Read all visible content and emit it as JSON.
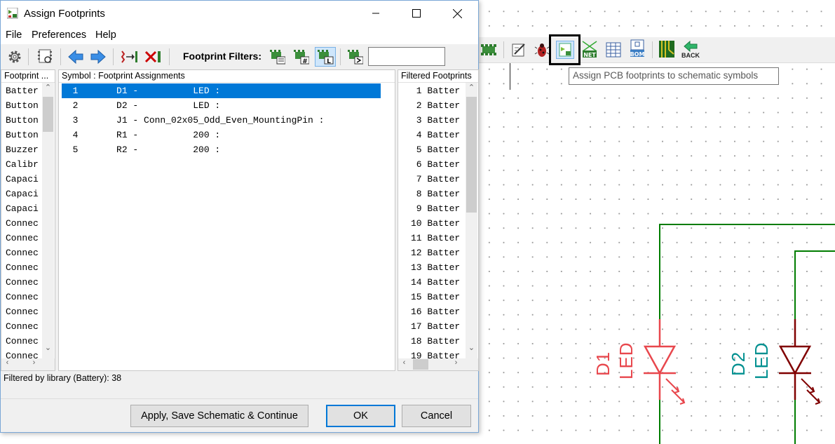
{
  "dialog": {
    "title": "Assign Footprints",
    "window_controls": [
      "minimize-icon",
      "maximize-icon",
      "close-icon"
    ]
  },
  "menu": [
    "File",
    "Preferences",
    "Help"
  ],
  "toolbar": {
    "filters_label": "Footprint Filters:",
    "filter_input_value": ""
  },
  "libraries_panel": {
    "header": "Footprint ...",
    "items": [
      "Batter",
      "Button",
      "Button",
      "Button",
      "Buzzer",
      "Calibr",
      "Capaci",
      "Capaci",
      "Capaci",
      "Connec",
      "Connec",
      "Connec",
      "Connec",
      "Connec",
      "Connec",
      "Connec",
      "Connec",
      "Connec",
      "Connec"
    ]
  },
  "assign_panel": {
    "header": "Symbol : Footprint Assignments",
    "rows": [
      {
        "text": "  1       D1 -          LED :",
        "selected": true
      },
      {
        "text": "  2       D2 -          LED :",
        "selected": false
      },
      {
        "text": "  3       J1 - Conn_02x05_Odd_Even_MountingPin :",
        "selected": false
      },
      {
        "text": "  4       R1 -          200 :",
        "selected": false
      },
      {
        "text": "  5       R2 -          200 :",
        "selected": false
      }
    ]
  },
  "footprints_panel": {
    "header": "Filtered Footprints",
    "items": [
      " 1 Batter",
      " 2 Batter",
      " 3 Batter",
      " 4 Batter",
      " 5 Batter",
      " 6 Batter",
      " 7 Batter",
      " 8 Batter",
      " 9 Batter",
      "10 Batter",
      "11 Batter",
      "12 Batter",
      "13 Batter",
      "14 Batter",
      "15 Batter",
      "16 Batter",
      "17 Batter",
      "18 Batter",
      "19 Batter"
    ]
  },
  "status": "Filtered by library (Battery): 38",
  "buttons": {
    "apply": "Apply, Save Schematic & Continue",
    "ok": "OK",
    "cancel": "Cancel"
  },
  "eeschema": {
    "tooltip": "Assign PCB footprints to schematic symbols",
    "back_label": "BACK",
    "net_label": "NET",
    "bom_label": "BOM",
    "components": [
      {
        "ref": "D1",
        "value": "LED",
        "color": "#e8474d"
      },
      {
        "ref": "D2",
        "value": "LED",
        "color": "#009090",
        "body_color": "#800000"
      }
    ],
    "wire_color": "#007c00"
  }
}
